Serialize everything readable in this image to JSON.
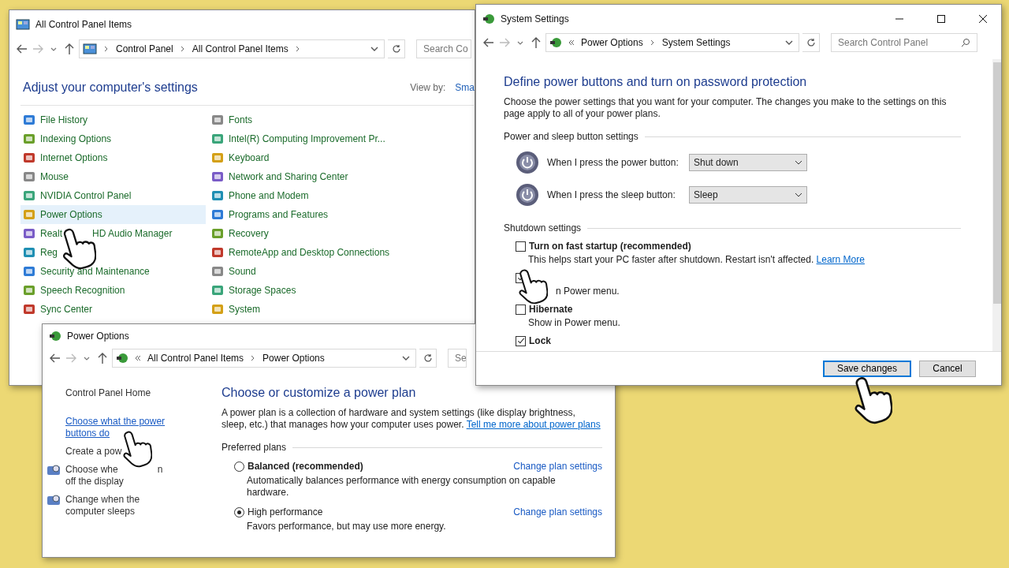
{
  "control_panel_window": {
    "title": "All Control Panel Items",
    "breadcrumb": [
      "Control Panel",
      "All Control Panel Items"
    ],
    "search": {
      "placeholder": "Search Co"
    },
    "heading": "Adjust your computer's settings",
    "view_by": {
      "label": "View by:",
      "value": "Sma"
    },
    "columns": [
      [
        {
          "label": "File History",
          "selected": false
        },
        {
          "label": "Indexing Options",
          "selected": false
        },
        {
          "label": "Internet Options",
          "selected": false
        },
        {
          "label": "Mouse",
          "selected": false
        },
        {
          "label": "NVIDIA Control Panel",
          "selected": false
        },
        {
          "label": "Power Options",
          "selected": true
        },
        {
          "label": "Realt",
          "label_tail": "HD Audio Manager",
          "selected": false
        },
        {
          "label": "Reg",
          "selected": false
        },
        {
          "label": "Security and Maintenance",
          "selected": false
        },
        {
          "label": "Speech Recognition",
          "selected": false
        },
        {
          "label": "Sync Center",
          "selected": false
        }
      ],
      [
        {
          "label": "Fonts",
          "selected": false
        },
        {
          "label": "Intel(R) Computing Improvement Pr...",
          "selected": false
        },
        {
          "label": "Keyboard",
          "selected": false
        },
        {
          "label": "Network and Sharing Center",
          "selected": false
        },
        {
          "label": "Phone and Modem",
          "selected": false
        },
        {
          "label": "Programs and Features",
          "selected": false
        },
        {
          "label": "Recovery",
          "selected": false
        },
        {
          "label": "RemoteApp and Desktop Connections",
          "selected": false
        },
        {
          "label": "Sound",
          "selected": false
        },
        {
          "label": "Storage Spaces",
          "selected": false
        },
        {
          "label": "System",
          "selected": false
        }
      ]
    ]
  },
  "power_options_window": {
    "title": "Power Options",
    "breadcrumb": [
      "All Control Panel Items",
      "Power Options"
    ],
    "search": {
      "placeholder": "Se"
    },
    "sidebar": [
      {
        "label": "Control Panel Home",
        "kind": "text",
        "hovered": false
      },
      {
        "label": "Choose what the power buttons do",
        "kind": "text",
        "hovered": true
      },
      {
        "label": "Create a pow",
        "kind": "text",
        "hovered": false
      },
      {
        "label": "Choose whe",
        "label_tail": "n off the display",
        "kind": "icon",
        "hovered": false
      },
      {
        "label": "Change when the computer sleeps",
        "kind": "icon",
        "hovered": false
      }
    ],
    "heading": "Choose or customize a power plan",
    "intro": "A power plan is a collection of hardware and system settings (like display brightness, sleep, etc.) that manages how your computer uses power.",
    "intro_link": "Tell me more about power plans",
    "section": "Preferred plans",
    "plans": [
      {
        "name": "Balanced (recommended)",
        "bold": true,
        "selected": false,
        "description": "Automatically balances performance with energy consumption on capable hardware.",
        "action": "Change plan settings"
      },
      {
        "name": "High performance",
        "bold": false,
        "selected": true,
        "description": "Favors performance, but may use more energy.",
        "action": "Change plan settings"
      }
    ]
  },
  "system_settings_window": {
    "title": "System Settings",
    "breadcrumb": [
      "Power Options",
      "System Settings"
    ],
    "search": {
      "placeholder": "Search Control Panel"
    },
    "heading": "Define power buttons and turn on password protection",
    "intro": "Choose the power settings that you want for your computer. The changes you make to the settings on this page apply to all of your power plans.",
    "button_section": "Power and sleep button settings",
    "button_rows": [
      {
        "label": "When I press the power button:",
        "value": "Shut down"
      },
      {
        "label": "When I press the sleep button:",
        "value": "Sleep"
      }
    ],
    "shutdown_section": "Shutdown settings",
    "shutdown_options": [
      {
        "label": "Turn on fast startup (recommended)",
        "checked": false,
        "description": "This helps start your PC faster after shutdown. Restart isn't affected.",
        "link": "Learn More"
      },
      {
        "checked": true,
        "description": "n Power menu."
      },
      {
        "label": "Hibernate",
        "checked": false,
        "description": "Show in Power menu."
      },
      {
        "label": "Lock",
        "checked": true
      }
    ],
    "buttons": [
      {
        "label": "Save changes",
        "default": true
      },
      {
        "label": "Cancel",
        "default": false
      }
    ]
  }
}
